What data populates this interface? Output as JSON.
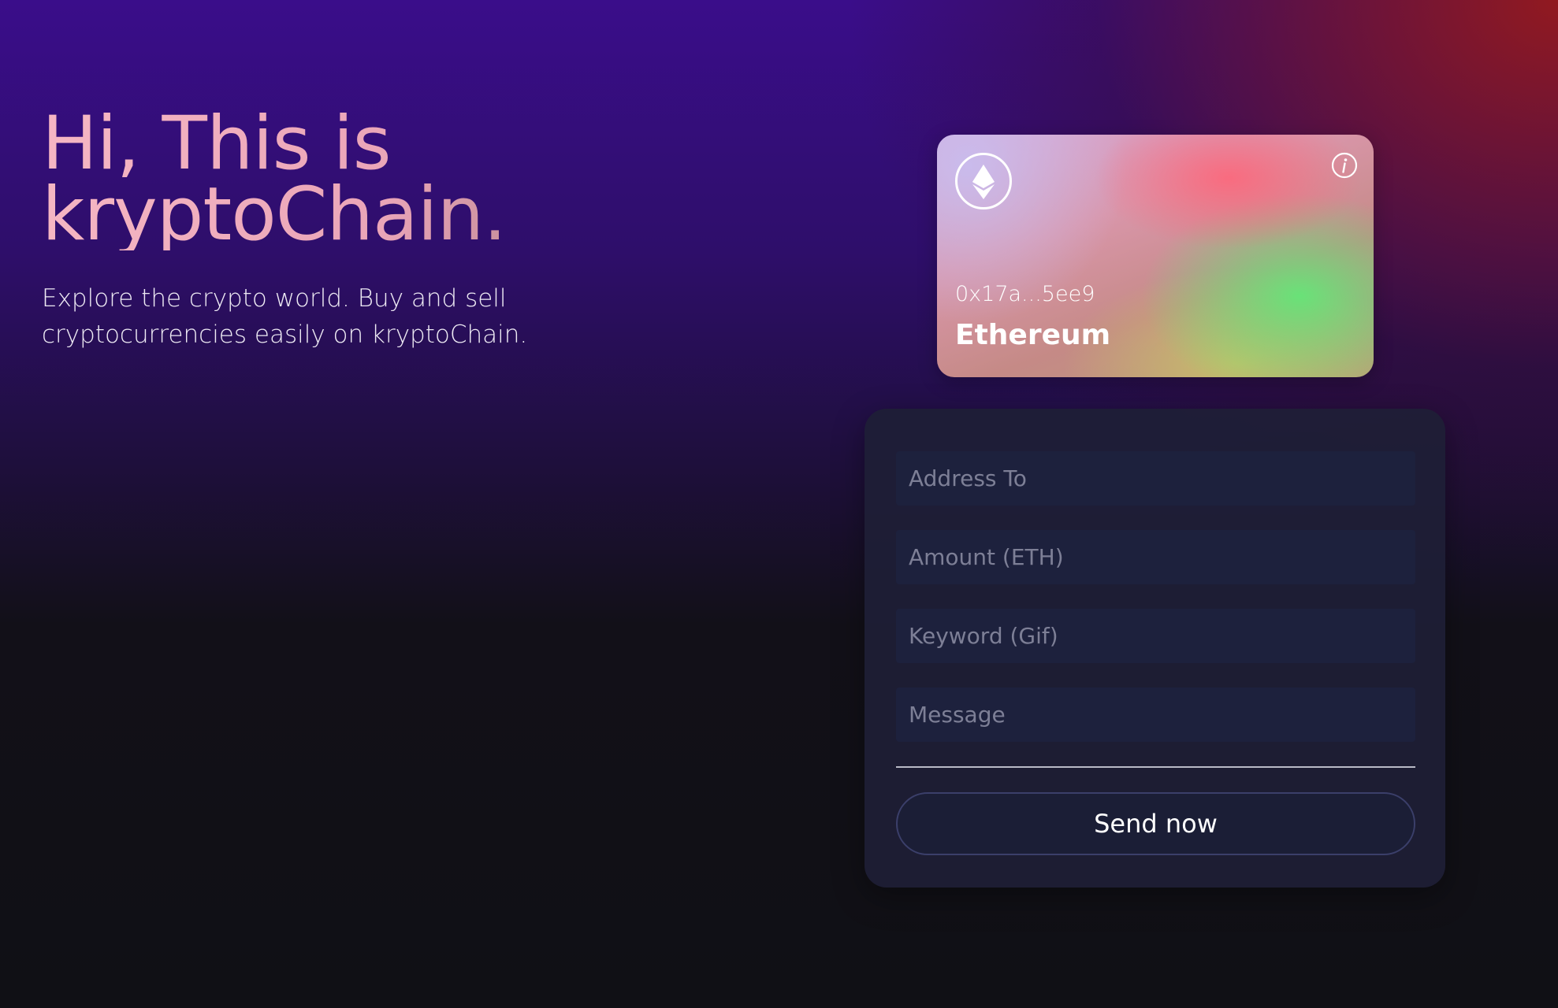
{
  "hero": {
    "title_line1": "Hi, This is",
    "title_line2": "kryptoChain.",
    "subtitle_line1": "Explore the crypto world. Buy and sell",
    "subtitle_line2": "cryptocurrencies easily on kryptoChain."
  },
  "card": {
    "address": "0x17a...5ee9",
    "network": "Ethereum",
    "logo_icon": "ethereum-icon",
    "info_icon": "info-icon"
  },
  "form": {
    "address_placeholder": "Address To",
    "amount_placeholder": "Amount (ETH)",
    "keyword_placeholder": "Keyword (Gif)",
    "message_placeholder": "Message",
    "send_label": "Send now"
  },
  "colors": {
    "background": "#101015",
    "purple": "#3a0d8a",
    "red": "#961a1a",
    "panel": "#1e1e36",
    "field": "#1d213d"
  }
}
